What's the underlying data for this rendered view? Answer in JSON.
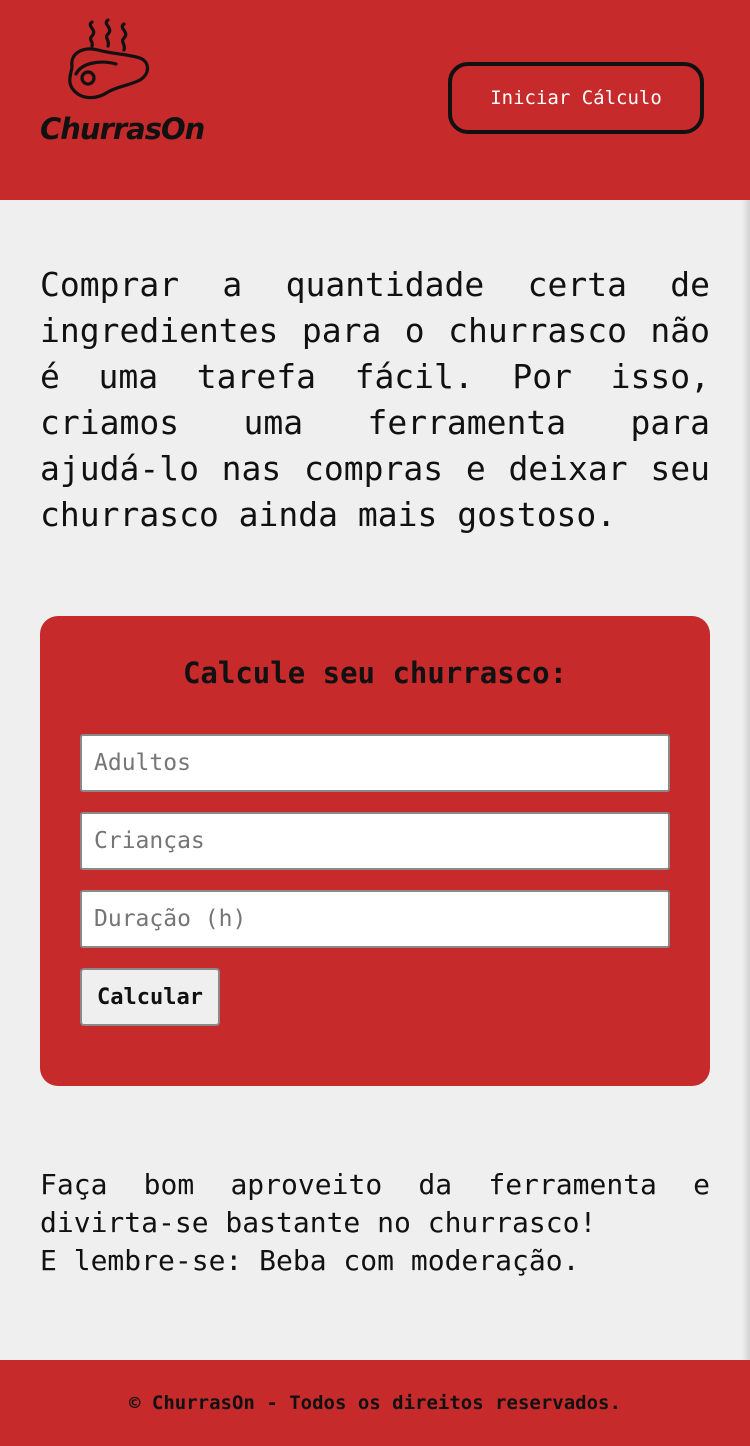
{
  "header": {
    "logo_text": "ChurrasOn",
    "logo_icon": "steak-icon",
    "start_button": "Iniciar Cálculo"
  },
  "intro": {
    "text": "Comprar a quantidade certa de ingredientes para o churrasco não é uma tarefa fácil. Por isso, criamos uma ferramenta para ajudá-lo nas compras e deixar seu churrasco ainda mais gostoso."
  },
  "calculator": {
    "title": "Calcule seu churrasco:",
    "adults_placeholder": "Adultos",
    "children_placeholder": "Crianças",
    "duration_placeholder": "Duração (h)",
    "submit_label": "Calcular"
  },
  "outro": {
    "line1": "Faça bom aproveito da ferramenta e divirta-se bastante no churrasco!",
    "line2": "E lembre-se: Beba com moderação."
  },
  "footer": {
    "text": "© ChurrasOn - Todos os direitos reservados."
  },
  "colors": {
    "primary_red": "#c62a2a",
    "background": "#efefef",
    "text": "#111111"
  }
}
